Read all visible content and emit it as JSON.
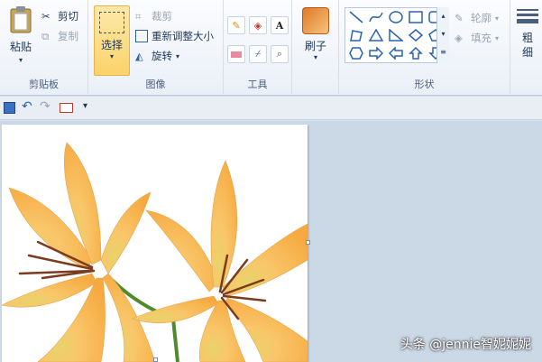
{
  "clipboard": {
    "paste_label": "粘贴",
    "cut_label": "剪切",
    "copy_label": "复制",
    "group_label": "剪贴板"
  },
  "image": {
    "select_label": "选择",
    "crop_label": "裁剪",
    "resize_label": "重新调整大小",
    "rotate_label": "旋转",
    "group_label": "图像"
  },
  "tools": {
    "group_label": "工具"
  },
  "brushes": {
    "label": "刷子"
  },
  "shapes": {
    "outline_label": "轮廓",
    "fill_label": "填充",
    "group_label": "形状"
  },
  "size": {
    "label": "粗细"
  },
  "watermark": "头条 @jennie智妮妮妮",
  "colors": {
    "selected_bg": "#fbd26a",
    "ribbon_bg": "#eaf0f7",
    "workspace_bg": "#cbd8e6",
    "petal": "#f7b955"
  }
}
